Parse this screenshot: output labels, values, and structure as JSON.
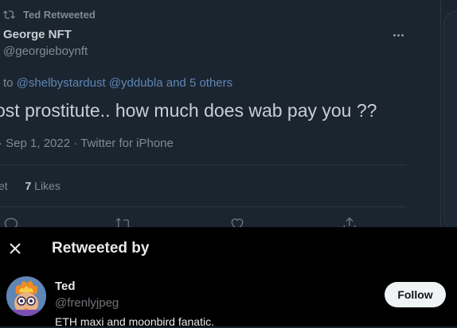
{
  "tweet": {
    "retweeted_by_label": "Ted Retweeted",
    "author_name": "George NFT",
    "author_handle": "@georgieboynft",
    "reply_prefix": "to ",
    "reply_mentions": "@shelbystardust @yddubla",
    "reply_suffix": " and 5 others",
    "text": "ost prostitute.. how much does wab pay you ??",
    "meta": "· Sep 1, 2022 · Twitter for iPhone",
    "stats": {
      "retweets_label": "et",
      "likes_count": "7",
      "likes_label": "Likes"
    }
  },
  "sheet": {
    "title": "Retweeted by",
    "user": {
      "name": "Ted",
      "handle": "@frenlyjpeg",
      "bio": "ETH maxi and moonbird fanatic.",
      "follow_label": "Follow"
    }
  },
  "icons": {
    "retweet": "retweet-icon",
    "more": "more-icon",
    "reply": "reply-icon",
    "like": "like-icon",
    "share": "share-icon",
    "close": "close-icon"
  },
  "colors": {
    "background": "#1b2530",
    "sheet_background": "#000000",
    "link": "#5f86b5",
    "follow_button": "#eff3f4"
  }
}
